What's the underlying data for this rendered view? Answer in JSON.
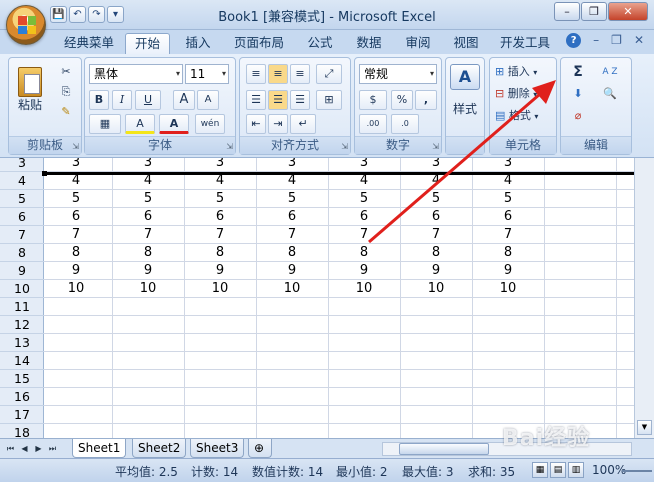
{
  "window": {
    "title": "Book1  [兼容模式] - Microsoft Excel",
    "minimize": "–",
    "restore": "❐",
    "close": "✕"
  },
  "qat": [
    "💾",
    "↶",
    "↷",
    "▾"
  ],
  "tabs": [
    "经典菜单",
    "开始",
    "插入",
    "页面布局",
    "公式",
    "数据",
    "审阅",
    "视图",
    "开发工具"
  ],
  "active_tab": "开始",
  "ribbon_right": {
    "help": "?",
    "minimize": "–",
    "restore": "❐",
    "close": "✕"
  },
  "ribbon": {
    "clipboard": {
      "label": "剪贴板",
      "paste": "粘贴",
      "cut": "✂",
      "copy": "⎘",
      "format_painter": "✎"
    },
    "font": {
      "label": "字体",
      "font_name": "黑体",
      "font_size": "11",
      "bold": "B",
      "italic": "I",
      "underline": "U",
      "grow": "A",
      "shrink": "A",
      "border": "▦",
      "fill": "A",
      "color": "A",
      "wen": "wén"
    },
    "alignment": {
      "label": "对齐方式"
    },
    "number": {
      "label": "数字",
      "format": "常规",
      "percent": "%",
      "comma": ",",
      "inc": ".00",
      "dec": ".0"
    },
    "styles": {
      "label": "样式",
      "icon": "A"
    },
    "cells": {
      "label": "单元格",
      "insert": "插入",
      "delete": "删除",
      "format": "格式"
    },
    "editing": {
      "label": "编辑",
      "sum": "Σ",
      "sort": "A Z",
      "fill": "⬇",
      "find": "🔍",
      "clear": "⌀"
    }
  },
  "rows": [
    3,
    4,
    5,
    6,
    7,
    8,
    9,
    10,
    11,
    12,
    13,
    14,
    15,
    16,
    17,
    18
  ],
  "cells": {
    "r3": [
      "3",
      "3",
      "3",
      "3",
      "3",
      "3",
      "3"
    ],
    "r4": [
      "4",
      "4",
      "4",
      "4",
      "4",
      "4",
      "4"
    ],
    "r5": [
      "5",
      "5",
      "5",
      "5",
      "5",
      "5",
      "5"
    ],
    "r6": [
      "6",
      "6",
      "6",
      "6",
      "6",
      "6",
      "6"
    ],
    "r7": [
      "7",
      "7",
      "7",
      "7",
      "7",
      "7",
      "7"
    ],
    "r8": [
      "8",
      "8",
      "8",
      "8",
      "8",
      "8",
      "8"
    ],
    "r9": [
      "9",
      "9",
      "9",
      "9",
      "9",
      "9",
      "9"
    ],
    "r10": [
      "10",
      "10",
      "10",
      "10",
      "10",
      "10",
      "10"
    ]
  },
  "sheet_tabs": [
    "Sheet1",
    "Sheet2",
    "Sheet3"
  ],
  "active_sheet": "Sheet1",
  "status": {
    "average": "平均值: 2.5",
    "count": "计数: 14",
    "numeric_count": "数值计数: 14",
    "min": "最小值: 2",
    "max": "最大值: 3",
    "sum": "求和: 35",
    "zoom": "100%"
  },
  "watermark": "Bai经验",
  "annotation_color": "#e0201c"
}
